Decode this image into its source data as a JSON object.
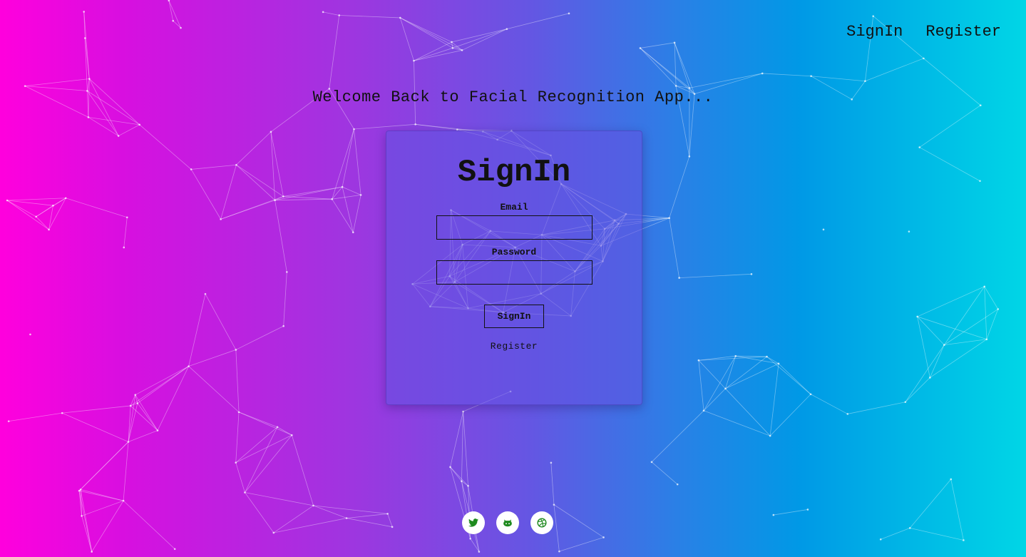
{
  "nav": {
    "signin": "SignIn",
    "register": "Register"
  },
  "welcome": "Welcome Back to Facial Recognition App...",
  "card": {
    "title": "SignIn",
    "email_label": "Email",
    "email_value": "",
    "password_label": "Password",
    "password_value": "",
    "submit_label": "SignIn",
    "register_link": "Register"
  },
  "social": [
    {
      "icon": "twitter-icon"
    },
    {
      "icon": "github-icon"
    },
    {
      "icon": "dribbble-icon"
    }
  ],
  "colors": {
    "gradient": [
      "#ff00dd",
      "#9c37e0",
      "#6357e3",
      "#0099e6",
      "#00d6e6"
    ],
    "icon_green": "#1e8a1e"
  }
}
